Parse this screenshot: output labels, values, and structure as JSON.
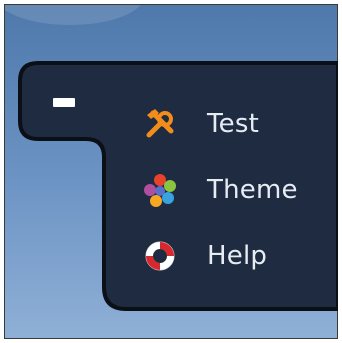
{
  "menu": {
    "collapse_glyph": "–",
    "items": [
      {
        "label": "Test",
        "icon": "tools-icon",
        "accent": "#f28c1b"
      },
      {
        "label": "Theme",
        "icon": "palette-icon",
        "accent": "#4aa3e0"
      },
      {
        "label": "Help",
        "icon": "lifebuoy-icon",
        "accent": "#d9282c"
      }
    ]
  },
  "colors": {
    "desktop_top": "#4f79ab",
    "desktop_bottom": "#8fb0d6",
    "panel_bg": "#1e2b40",
    "panel_border": "#0b0f16",
    "text": "#e7ecf3"
  }
}
